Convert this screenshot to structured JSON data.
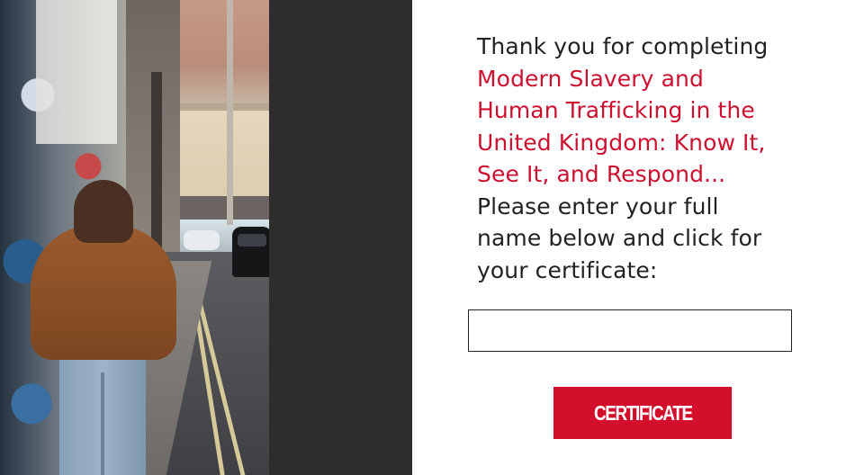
{
  "panel": {
    "intro_line": "Thank you for completing",
    "course_lines": [
      "Modern Slavery and",
      "Human Trafficking in the",
      "United Kingdom: Know It,",
      "See It, and Respond..."
    ],
    "instruction_lines": [
      "Please enter your full",
      "name below and click for",
      "your certificate:"
    ]
  },
  "form": {
    "name_value": "",
    "name_placeholder": "",
    "button_label": "CERTIFICATE"
  },
  "colors": {
    "accent": "#cc1130",
    "button": "#d40f2c",
    "band": "#2f2c2d",
    "text": "#222222"
  },
  "image": {
    "icon": "alley-photo"
  }
}
